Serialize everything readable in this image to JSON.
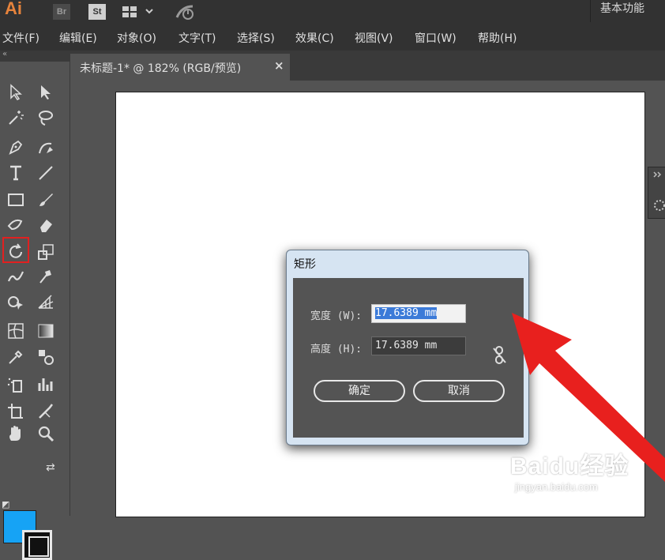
{
  "app": {
    "logo": "Ai",
    "bridge_label": "Br",
    "stock_label": "St",
    "workspace": "基本功能"
  },
  "menu": [
    {
      "label": "文件(F)"
    },
    {
      "label": "编辑(E)"
    },
    {
      "label": "对象(O)"
    },
    {
      "label": "文字(T)"
    },
    {
      "label": "选择(S)"
    },
    {
      "label": "效果(C)"
    },
    {
      "label": "视图(V)"
    },
    {
      "label": "窗口(W)"
    },
    {
      "label": "帮助(H)"
    }
  ],
  "document": {
    "tab_title": "未标题-1* @ 182% (RGB/预览)",
    "close": "×"
  },
  "tools": [
    "selection-tool",
    "direct-selection-tool",
    "magic-wand-tool",
    "lasso-tool",
    "pen-tool",
    "curvature-tool",
    "type-tool",
    "line-tool",
    "rectangle-tool",
    "paintbrush-tool",
    "shaper-tool",
    "eraser-tool",
    "rotate-tool",
    "scale-tool",
    "warp-tool",
    "puppet-warp-tool",
    "shape-builder-tool",
    "perspective-grid-tool",
    "mesh-tool",
    "gradient-tool",
    "eyedropper-tool",
    "blend-tool",
    "symbol-sprayer-tool",
    "column-graph-tool",
    "artboard-tool",
    "slice-tool",
    "hand-tool",
    "zoom-tool"
  ],
  "colors": {
    "fill": "#16a3f5",
    "stroke": "#111111",
    "highlight": "#e12020",
    "arrow": "#e8201e"
  },
  "dialog": {
    "title": "矩形",
    "width_label": "宽度 (W):",
    "width_value": "17.6389 mm",
    "height_label": "高度 (H):",
    "height_value": "17.6389 mm",
    "ok_label": "确定",
    "cancel_label": "取消"
  },
  "watermark": {
    "text": "Baidu经验",
    "url": "jingyan.baidu.com"
  }
}
